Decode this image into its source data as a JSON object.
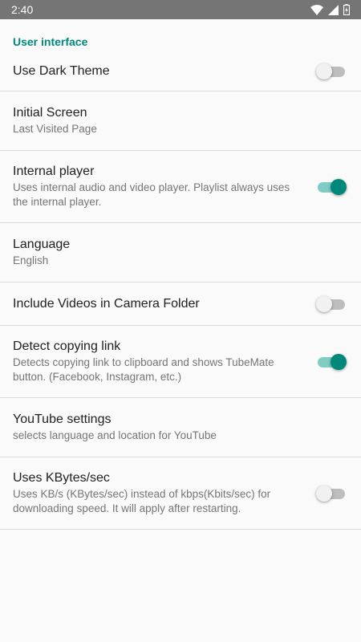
{
  "status_bar": {
    "time": "2:40"
  },
  "section": {
    "title": "User interface"
  },
  "prefs": [
    {
      "title": "Use Dark Theme",
      "summary": "",
      "toggle": false
    },
    {
      "title": "Initial Screen",
      "summary": "Last Visited Page"
    },
    {
      "title": "Internal player",
      "summary": "Uses internal audio and video player. Playlist always uses the internal player.",
      "toggle": true
    },
    {
      "title": "Language",
      "summary": "English"
    },
    {
      "title": "Include Videos in Camera Folder",
      "summary": "",
      "toggle": false
    },
    {
      "title": "Detect copying link",
      "summary": "Detects copying link to clipboard and shows TubeMate button. (Facebook, Instagram, etc.)",
      "toggle": true
    },
    {
      "title": "YouTube settings",
      "summary": "selects language and location for YouTube"
    },
    {
      "title": "Uses KBytes/sec",
      "summary": "Uses KB/s (KBytes/sec) instead of kbps(Kbits/sec) for downloading speed. It will apply after restarting.",
      "toggle": false
    }
  ],
  "colors": {
    "accent": "#00897b",
    "accent_light": "#80cbc4",
    "status_bar": "#757575"
  },
  "icons": [
    "wifi-icon",
    "signal-icon",
    "battery-icon"
  ]
}
